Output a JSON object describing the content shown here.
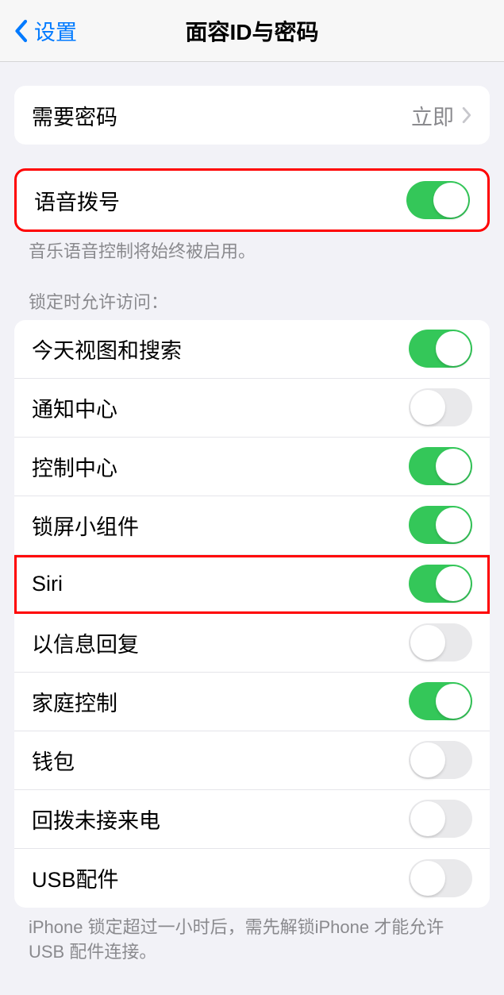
{
  "nav": {
    "back_label": "设置",
    "title": "面容ID与密码"
  },
  "passcode": {
    "require_label": "需要密码",
    "require_value": "立即"
  },
  "voice_dial": {
    "label": "语音拨号",
    "on": true,
    "footer": "音乐语音控制将始终被启用。"
  },
  "lock_access": {
    "header": "锁定时允许访问：",
    "items": [
      {
        "label": "今天视图和搜索",
        "on": true
      },
      {
        "label": "通知中心",
        "on": false
      },
      {
        "label": "控制中心",
        "on": true
      },
      {
        "label": "锁屏小组件",
        "on": true
      },
      {
        "label": "Siri",
        "on": true
      },
      {
        "label": "以信息回复",
        "on": false
      },
      {
        "label": "家庭控制",
        "on": true
      },
      {
        "label": "钱包",
        "on": false
      },
      {
        "label": "回拨未接来电",
        "on": false
      },
      {
        "label": "USB配件",
        "on": false
      }
    ],
    "footer": "iPhone 锁定超过一小时后，需先解锁iPhone 才能允许USB 配件连接。"
  }
}
